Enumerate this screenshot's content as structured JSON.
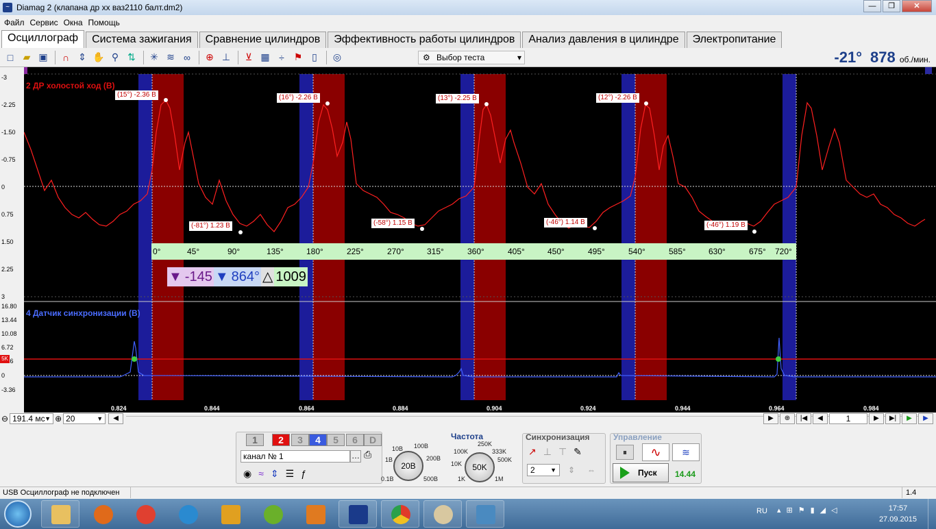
{
  "window": {
    "title": "Diamag 2 (клапана др хх ваз2110 балт.dm2)",
    "btn_min": "—",
    "btn_max": "❐",
    "btn_close": "✕"
  },
  "menu": [
    "Файл",
    "Сервис",
    "Окна",
    "Помощь"
  ],
  "tabs": [
    "Осциллограф",
    "Система зажигания",
    "Сравнение цилиндров",
    "Эффективность работы цилиндров",
    "Анализ давления в цилиндре",
    "Электропитание"
  ],
  "toolbar": {
    "test_select": "Выбор теста",
    "angle": "-21°",
    "rpm": "878",
    "rpm_unit": "об./мин."
  },
  "channel1": {
    "title": "2 ДР холостой ход (В)",
    "y_labels": [
      "-3",
      "-2.25",
      "-1.50",
      "-0.75",
      "0",
      "0.75",
      "1.50",
      "2.25",
      "3"
    ],
    "markers": [
      "(15°) -2.36 В",
      "(16°) -2.26 В",
      "(13°) -2.25 В",
      "(12°) -2.26 В",
      "(-81°) 1.23 В",
      "(-58°) 1.15 В",
      "(-46°) 1.14 В",
      "(-46°) 1.19 В"
    ]
  },
  "degree_scale": [
    "0°",
    "45°",
    "90°",
    "135°",
    "180°",
    "225°",
    "270°",
    "315°",
    "360°",
    "405°",
    "450°",
    "495°",
    "540°",
    "585°",
    "630°",
    "675°",
    "720°"
  ],
  "cursor": {
    "c1": "-145",
    "c2": "864°",
    "delta_sym": "△",
    "delta": "1009"
  },
  "channel2": {
    "title": "4 Датчик синхронизации (В)",
    "y_labels": [
      "16.80",
      "13.44",
      "10.08",
      "6.72",
      "3.36",
      "0",
      "-3.36"
    ],
    "trigger": "5K"
  },
  "x_labels": [
    "0.824",
    "0.844",
    "0.864",
    "0.884",
    "0.904",
    "0.924",
    "0.944",
    "0.964",
    "0.984"
  ],
  "zoom": {
    "time": "191.4 мс",
    "amp": "20",
    "page": "1"
  },
  "bottom": {
    "channels": [
      "1",
      "2",
      "3",
      "4",
      "5",
      "6",
      "D"
    ],
    "channel_name": "канал № 1",
    "volt_knob": "20В",
    "volt_labels": [
      "10В",
      "100В",
      "1В",
      "200В",
      "0.1В",
      "500В"
    ],
    "freq_title": "Частота",
    "freq_knob": "50K",
    "freq_labels": [
      "250K",
      "100K",
      "333K",
      "10K",
      "500K",
      "1K",
      "1M"
    ],
    "sync_title": "Синхронизация",
    "sync_value": "2",
    "control_title": "Управление",
    "run_label": "Пуск",
    "run_value": "14.44"
  },
  "status": {
    "left": "USB Осциллограф не подключен",
    "right": "1.4"
  },
  "taskbar": {
    "lang": "RU",
    "time": "17:57",
    "date": "27.09.2015"
  },
  "colors": {
    "signal": "#ff2020",
    "sync": "#4060ff",
    "red_band": "#8a0000",
    "blue_band": "#1c1c9a"
  }
}
